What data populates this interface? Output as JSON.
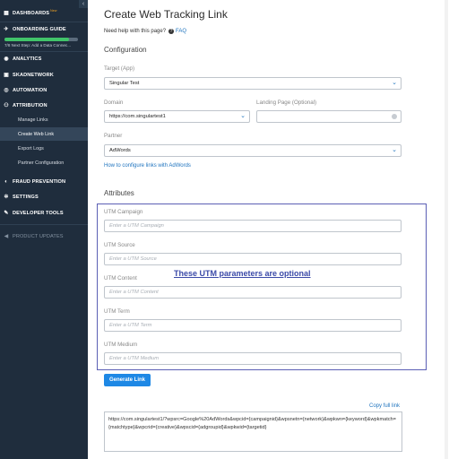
{
  "sidebar": {
    "collapse_glyph": "‹",
    "items": [
      {
        "label": "DASHBOARDS",
        "badge": "New",
        "icon": "dashboard-icon"
      },
      {
        "label": "ONBOARDING GUIDE",
        "icon": "rocket-icon"
      },
      {
        "label": "ANALYTICS",
        "icon": "analytics-icon"
      },
      {
        "label": "SKADNETWORK",
        "icon": "skadnetwork-icon"
      },
      {
        "label": "AUTOMATION",
        "icon": "automation-icon"
      },
      {
        "label": "ATTRIBUTION",
        "icon": "attribution-icon"
      },
      {
        "label": "FRAUD PREVENTION",
        "icon": "shield-icon"
      },
      {
        "label": "SETTINGS",
        "icon": "gear-icon"
      },
      {
        "label": "DEVELOPER TOOLS",
        "icon": "wrench-icon"
      },
      {
        "label": "PRODUCT UPDATES",
        "icon": "megaphone-icon"
      }
    ],
    "onboarding_progress": 0.875,
    "onboarding_step": "7/8 Next Step: Add a Data Connec...",
    "sub_items": [
      "Manage Links",
      "Create Web Link",
      "Export Logs",
      "Partner Configuration"
    ],
    "active_sub": "Create Web Link"
  },
  "page": {
    "title": "Create Web Tracking Link",
    "help_text": "Need help with this page?",
    "faq": "FAQ",
    "configuration": "Configuration",
    "attributes": "Attributes"
  },
  "config": {
    "target_label": "Target (App)",
    "target_value": "Singular Test",
    "domain_label": "Domain",
    "domain_value": "https://com.singulartest1",
    "landing_label": "Landing Page (Optional)",
    "landing_value": "",
    "partner_label": "Partner",
    "partner_value": "AdWords",
    "partner_help": "How to configure links with AdWords"
  },
  "utm": [
    {
      "label": "UTM Campaign",
      "placeholder": "Enter a UTM Campaign"
    },
    {
      "label": "UTM Source",
      "placeholder": "Enter a UTM Source"
    },
    {
      "label": "UTM Content",
      "placeholder": "Enter a UTM Content"
    },
    {
      "label": "UTM Term",
      "placeholder": "Enter a UTM Term"
    },
    {
      "label": "UTM Medium",
      "placeholder": "Enter a UTM Medium"
    }
  ],
  "optional_note": "These UTM parameters are optional",
  "generate_button": "Generate Link",
  "copy_full_link": "Copy full link",
  "generated_url": "https://com.singulartest1/?wpsrc=Google%20AdWords&wpcid={campaignid}&wpsnetn={network}&wpkwn={keyword}&wpkmatch={matchtype}&wpcrid={creative}&wpscid={adgroupid}&wpkwid={targetid}",
  "colors": {
    "sidebar_bg": "#1f2d3d",
    "accent": "#1e88e5",
    "highlight_box": "#5b5fb5",
    "progress": "#41c46a"
  }
}
